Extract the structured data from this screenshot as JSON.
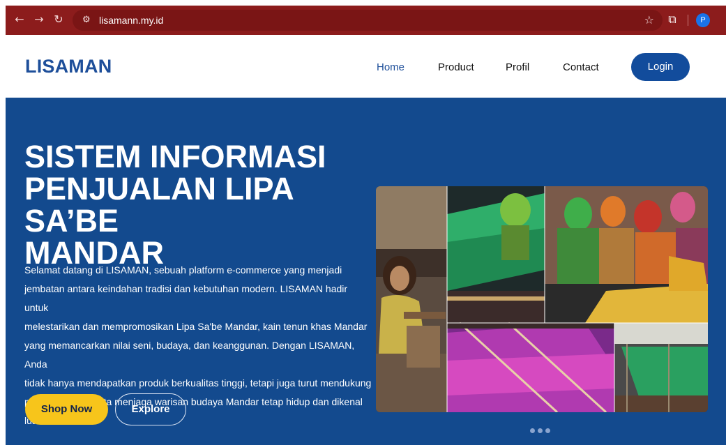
{
  "browser": {
    "url": "lisamann.my.id",
    "profile_initial": "P",
    "icons": [
      "back-arrow-icon",
      "forward-arrow-icon",
      "reload-icon",
      "site-settings-icon",
      "bookmark-star-icon",
      "extensions-icon",
      "profile-avatar",
      "more-menu-icon"
    ]
  },
  "header": {
    "brand": "LISAMAN",
    "nav": [
      {
        "label": "Home",
        "active": true
      },
      {
        "label": "Product",
        "active": false
      },
      {
        "label": "Profil",
        "active": false
      },
      {
        "label": "Contact",
        "active": false
      }
    ],
    "login_label": "Login"
  },
  "hero": {
    "title_lines": [
      "SISTEM INFORMASI",
      "PENJUALAN LIPA SA’BE",
      "MANDAR"
    ],
    "description_lines": [
      "Selamat datang di LISAMAN, sebuah platform e-commerce yang menjadi",
      "jembatan antara keindahan tradisi dan kebutuhan modern. LISAMAN hadir untuk",
      "melestarikan dan mempromosikan Lipa Sa'be Mandar, kain tenun khas Mandar",
      "yang memancarkan nilai seni, budaya, dan keanggunan. Dengan LISAMAN, Anda",
      "tidak hanya mendapatkan produk berkualitas tinggi, tetapi juga turut mendukung",
      "pengrajin lokal serta menjaga warisan budaya Mandar tetap hidup dan dikenal lua"
    ],
    "shop_label": "Shop Now",
    "explore_label": "Explore",
    "carousel_slide_count": 3
  },
  "colors": {
    "browser_bar": "#8c1c1c",
    "brand_blue": "#1e4f9a",
    "hero_bg": "#134a8e",
    "login_bg": "#124c9c",
    "shop_btn": "#f7c51b"
  }
}
